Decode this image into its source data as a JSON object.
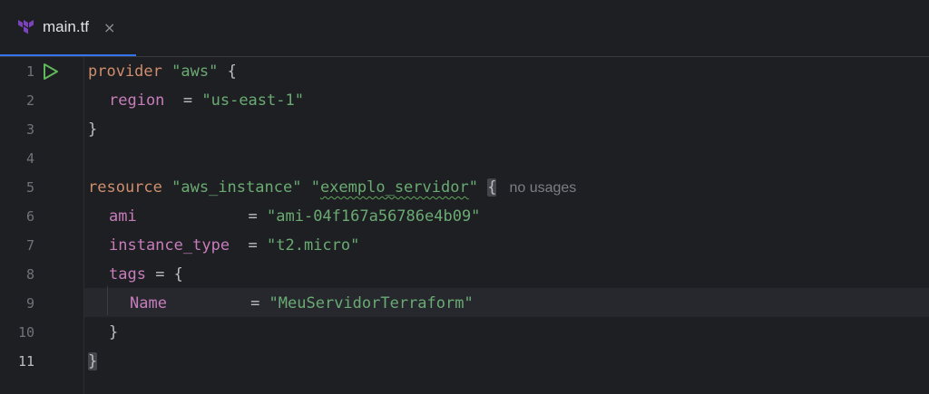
{
  "tab": {
    "label": "main.tf",
    "close_glyph": "×",
    "icon": "terraform-icon"
  },
  "gutter": {
    "line_numbers": [
      "1",
      "2",
      "3",
      "4",
      "5",
      "6",
      "7",
      "8",
      "9",
      "10",
      "11"
    ],
    "run_icon": "run-icon",
    "current_line": "11"
  },
  "code": {
    "l1": {
      "kw": "provider",
      "s1": "\"aws\"",
      "brace": "{"
    },
    "l2": {
      "prop": "region",
      "eq": "  = ",
      "val": "\"us-east-1\""
    },
    "l3": {
      "brace": "}"
    },
    "l5": {
      "kw": "resource",
      "s1": "\"aws_instance\"",
      "q1": "\"",
      "name": "exemplo_servidor",
      "q2": "\"",
      "brace": "{",
      "hint": "no usages"
    },
    "l6": {
      "prop": "ami",
      "eq": "            = ",
      "val": "\"ami-04f167a56786e4b09\""
    },
    "l7": {
      "prop": "instance_type",
      "eq": "  = ",
      "val": "\"t2.micro\""
    },
    "l8": {
      "prop": "tags",
      "eq": " = ",
      "brace": "{"
    },
    "l9": {
      "prop": "Name",
      "eq": "         = ",
      "val": "\"MeuServidorTerraform\""
    },
    "l10": {
      "brace": "}"
    },
    "l11": {
      "brace": "}"
    }
  },
  "colors": {
    "background": "#1e1f22",
    "keyword": "#cf8e6d",
    "string": "#6aab73",
    "property": "#c77dbb",
    "text": "#bcbec4",
    "tab_underline": "#3574f0",
    "terraform_purple": "#7b42bc",
    "run_green": "#5fb85a"
  }
}
